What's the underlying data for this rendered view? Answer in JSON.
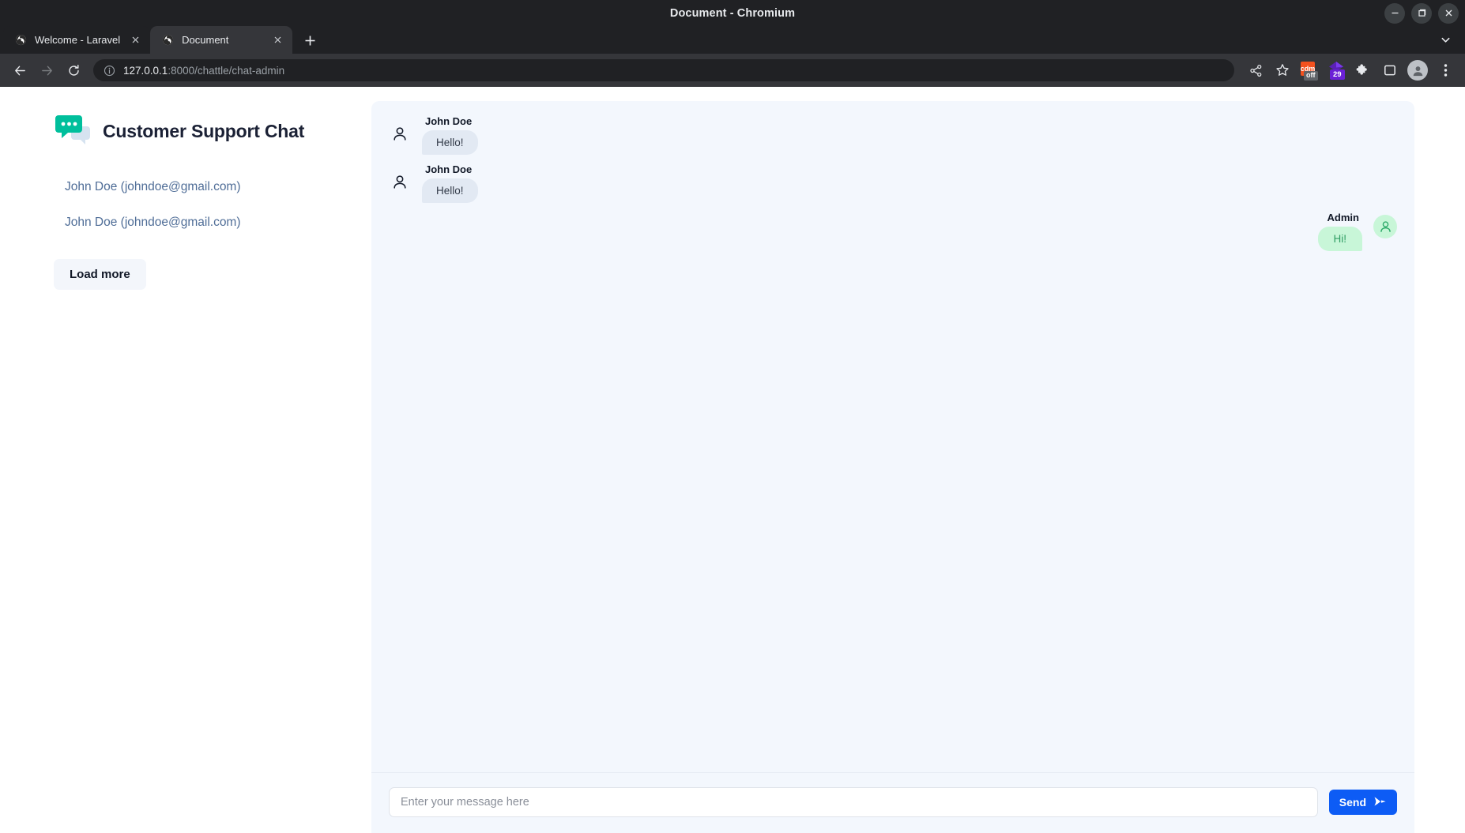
{
  "window": {
    "title": "Document - Chromium",
    "controls": {
      "minimize": "minimize-icon",
      "maximize": "maximize-icon",
      "close": "close-icon"
    }
  },
  "tabs": [
    {
      "title": "Welcome - Laravel",
      "active": false
    },
    {
      "title": "Document",
      "active": true
    }
  ],
  "tabstrip": {
    "new_tab_label": "+",
    "tab_search_icon": "chevron-down-icon"
  },
  "toolbar": {
    "back_icon": "back-arrow-icon",
    "forward_icon": "forward-arrow-icon",
    "reload_icon": "reload-icon",
    "info_icon": "info-circle-icon",
    "url_host": "127.0.0.1",
    "url_path": ":8000/chattle/chat-admin",
    "url_full": "127.0.0.1:8000/chattle/chat-admin",
    "share_icon": "share-icon",
    "bookmark_icon": "star-icon",
    "extensions": [
      {
        "name": "cdm-extension-icon",
        "label": "cdm",
        "badge": "off"
      },
      {
        "name": "purple-diamond-extension-icon",
        "badge": "29"
      }
    ],
    "puzzle_icon": "puzzle-piece-icon",
    "sidepanel_icon": "side-panel-icon",
    "profile_icon": "profile-avatar-icon",
    "menu_icon": "three-dot-menu-icon"
  },
  "app": {
    "brand_title": "Customer Support Chat",
    "logo_icon": "chat-bubble-logo",
    "contacts": [
      {
        "label": "John Doe (johndoe@gmail.com)"
      },
      {
        "label": "John Doe (johndoe@gmail.com)"
      }
    ],
    "load_more_label": "Load more",
    "messages": [
      {
        "author": "John Doe",
        "text": "Hello!",
        "side": "in",
        "avatar": "person-icon"
      },
      {
        "author": "John Doe",
        "text": "Hello!",
        "side": "in",
        "avatar": "person-icon"
      },
      {
        "author": "Admin",
        "text": "Hi!",
        "side": "out",
        "avatar": "person-circle-icon"
      }
    ],
    "composer": {
      "placeholder": "Enter your message here",
      "value": "",
      "send_label": "Send",
      "send_icon": "send-arrow-icon"
    },
    "colors": {
      "brand_teal": "#00bf9c",
      "panel_bg": "#f3f7fd",
      "incoming_bubble": "#e2e9f3",
      "outgoing_bubble": "#c8f6d8",
      "outgoing_text": "#2f9d63",
      "send_button": "#0d5cf5",
      "contact_link": "#4f6d97"
    }
  }
}
